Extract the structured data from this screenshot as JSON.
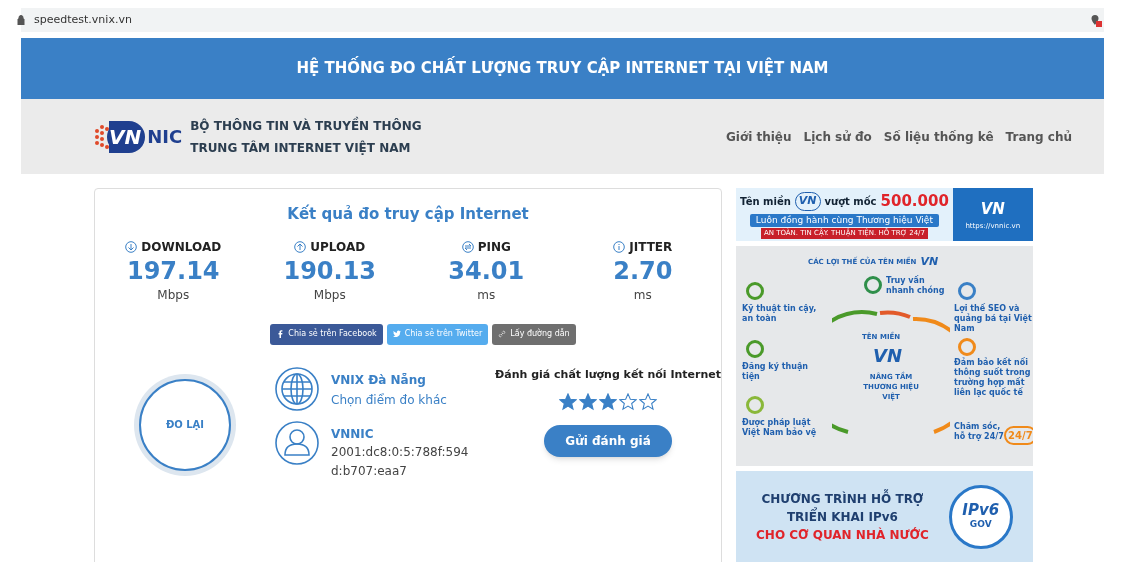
{
  "browser": {
    "url": "speedtest.vnix.vn"
  },
  "banner": {
    "title": "HỆ THỐNG ĐO CHẤT LƯỢNG TRUY CẬP INTERNET TẠI VIỆT NAM"
  },
  "header": {
    "logo": {
      "mark": "VN",
      "name": "NIC"
    },
    "org_lines": [
      "BỘ THÔNG TIN VÀ TRUYỀN THÔNG",
      "TRUNG TÂM INTERNET VIỆT NAM"
    ],
    "nav": [
      "Giới thiệu",
      "Lịch sử đo",
      "Số liệu thống kê",
      "Trang chủ"
    ]
  },
  "result": {
    "title": "Kết quả đo truy cập Internet",
    "metrics": [
      {
        "kind": "download",
        "label": "DOWNLOAD",
        "value": "197.14",
        "unit": "Mbps"
      },
      {
        "kind": "upload",
        "label": "UPLOAD",
        "value": "190.13",
        "unit": "Mbps"
      },
      {
        "kind": "ping",
        "label": "PING",
        "value": "34.01",
        "unit": "ms"
      },
      {
        "kind": "jitter",
        "label": "JITTER",
        "value": "2.70",
        "unit": "ms"
      }
    ],
    "share_buttons": [
      {
        "kind": "facebook",
        "label": "Chia sẻ trên Facebook"
      },
      {
        "kind": "twitter",
        "label": "Chia sẻ trên Twitter"
      },
      {
        "kind": "link",
        "label": "Lấy đường dẫn"
      }
    ],
    "retest_button": "ĐO LẠI",
    "server": {
      "name": "VNIX Đà Nẵng",
      "link": "Chọn điểm đo khác"
    },
    "client": {
      "isp": "VNNIC",
      "ip": "2001:dc8:0:5:788f:594d:b707:eaa7"
    },
    "rating": {
      "title": "Đánh giá chất lượng kết nối Internet",
      "stars": 3,
      "submit": "Gửi đánh giá"
    }
  },
  "ads": {
    "domain_banner": {
      "prefix": "Tên miền",
      "mark": "VN",
      "middle": "vượt mốc",
      "count": "500.000",
      "slogan": "Luôn đồng hành cùng Thương hiệu Việt",
      "tagline": "AN TOÀN. TIN CẬY. THUẬN TIỆN. HỖ TRỢ 24/7",
      "side_mark": "VN",
      "url": "https://vnnic.vn"
    },
    "infographic": {
      "title": "CÁC LỢI THẾ CỦA TÊN MIỀN",
      "mark": "VN",
      "center_label": "TÊN MIỀN",
      "center_mark": "VN",
      "center_text": "NÂNG TẦM THƯƠNG HIỆU VIỆT",
      "badge": "24/7",
      "benefits": [
        "Kỹ thuật tin cậy, an toàn",
        "Truy vấn nhanh chóng",
        "Lợi thế SEO và quảng bá tại Việt Nam",
        "Đăng ký thuận tiện",
        "Đảm bảo kết nối thông suốt trong trường hợp mất liên lạc quốc tế",
        "Được pháp luật Việt Nam bảo vệ",
        "Chăm sóc, hỗ trợ 24/7"
      ]
    },
    "ipv6_banner": {
      "lines": [
        "CHƯƠNG TRÌNH HỖ TRỢ",
        "TRIỂN KHAI IPv6",
        "CHO CƠ QUAN NHÀ NƯỚC"
      ],
      "badge": "IPv6",
      "badge_sub": "GOV"
    }
  }
}
